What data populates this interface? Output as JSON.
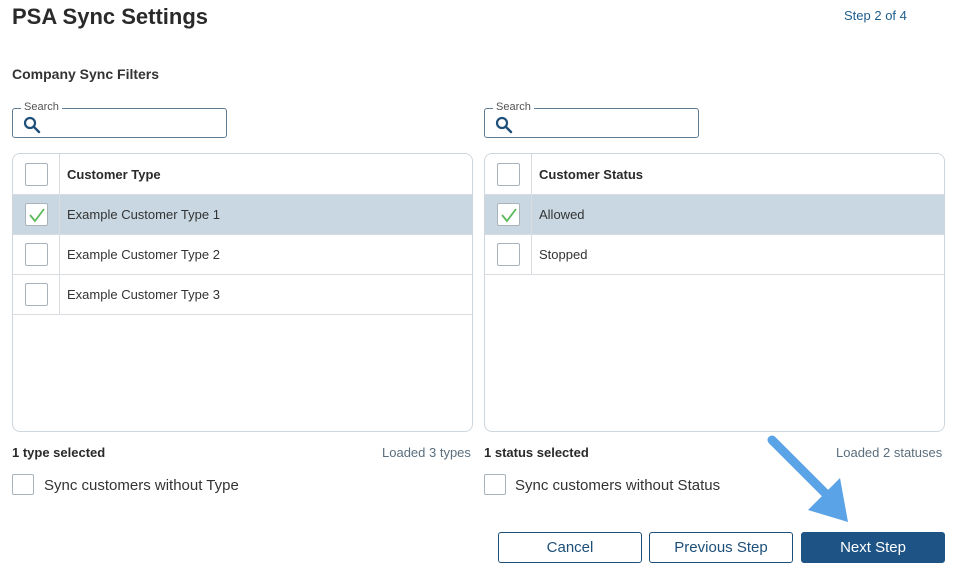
{
  "header": {
    "title": "PSA Sync Settings",
    "step": "Step 2 of 4"
  },
  "section": {
    "title": "Company Sync Filters"
  },
  "type_panel": {
    "search_legend": "Search",
    "search_value": "",
    "column_header": "Customer Type",
    "rows": [
      {
        "label": "Example Customer Type 1",
        "checked": true
      },
      {
        "label": "Example Customer Type 2",
        "checked": false
      },
      {
        "label": "Example Customer Type 3",
        "checked": false
      }
    ],
    "summary": "1 type selected",
    "loaded": "Loaded 3 types",
    "sync_label": "Sync customers without Type"
  },
  "status_panel": {
    "search_legend": "Search",
    "search_value": "",
    "column_header": "Customer Status",
    "rows": [
      {
        "label": "Allowed",
        "checked": true
      },
      {
        "label": "Stopped",
        "checked": false
      }
    ],
    "summary": "1 status selected",
    "loaded": "Loaded 2 statuses",
    "sync_label": "Sync customers without Status"
  },
  "footer": {
    "cancel": "Cancel",
    "previous": "Previous Step",
    "next": "Next Step"
  },
  "colors": {
    "primary": "#1e5485",
    "selected_row": "#c8d7e1",
    "check": "#5cb85c",
    "arrow": "#5aa3e6"
  }
}
